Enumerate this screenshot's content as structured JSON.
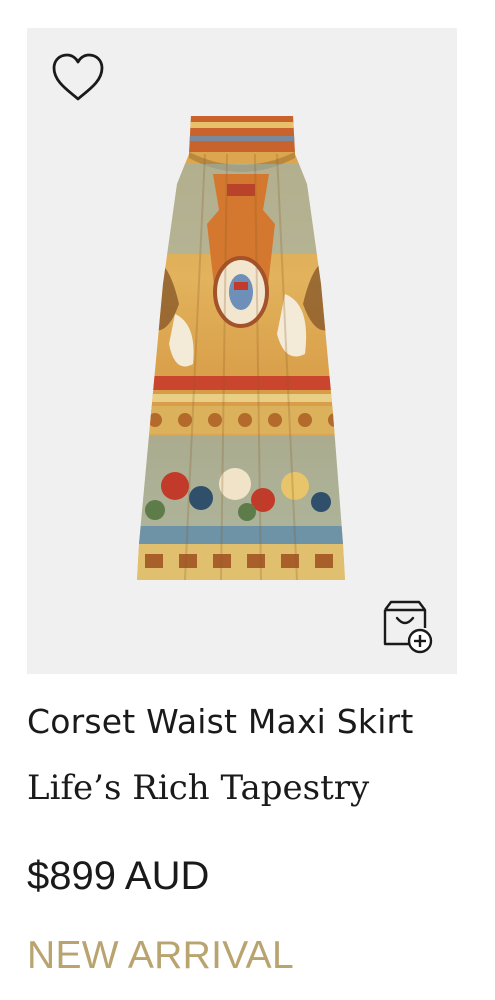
{
  "product": {
    "name": "Corset Waist Maxi Skirt",
    "collection": "Life’s Rich Tapestry",
    "price": "$899 AUD",
    "badge": "NEW ARRIVAL"
  },
  "icons": {
    "wishlist": "heart-outline-icon",
    "cart": "shopping-bag-add-icon"
  },
  "colors": {
    "image_background": "#f0f0f0",
    "text": "#1a1a1a",
    "badge": "#b9a36f"
  }
}
